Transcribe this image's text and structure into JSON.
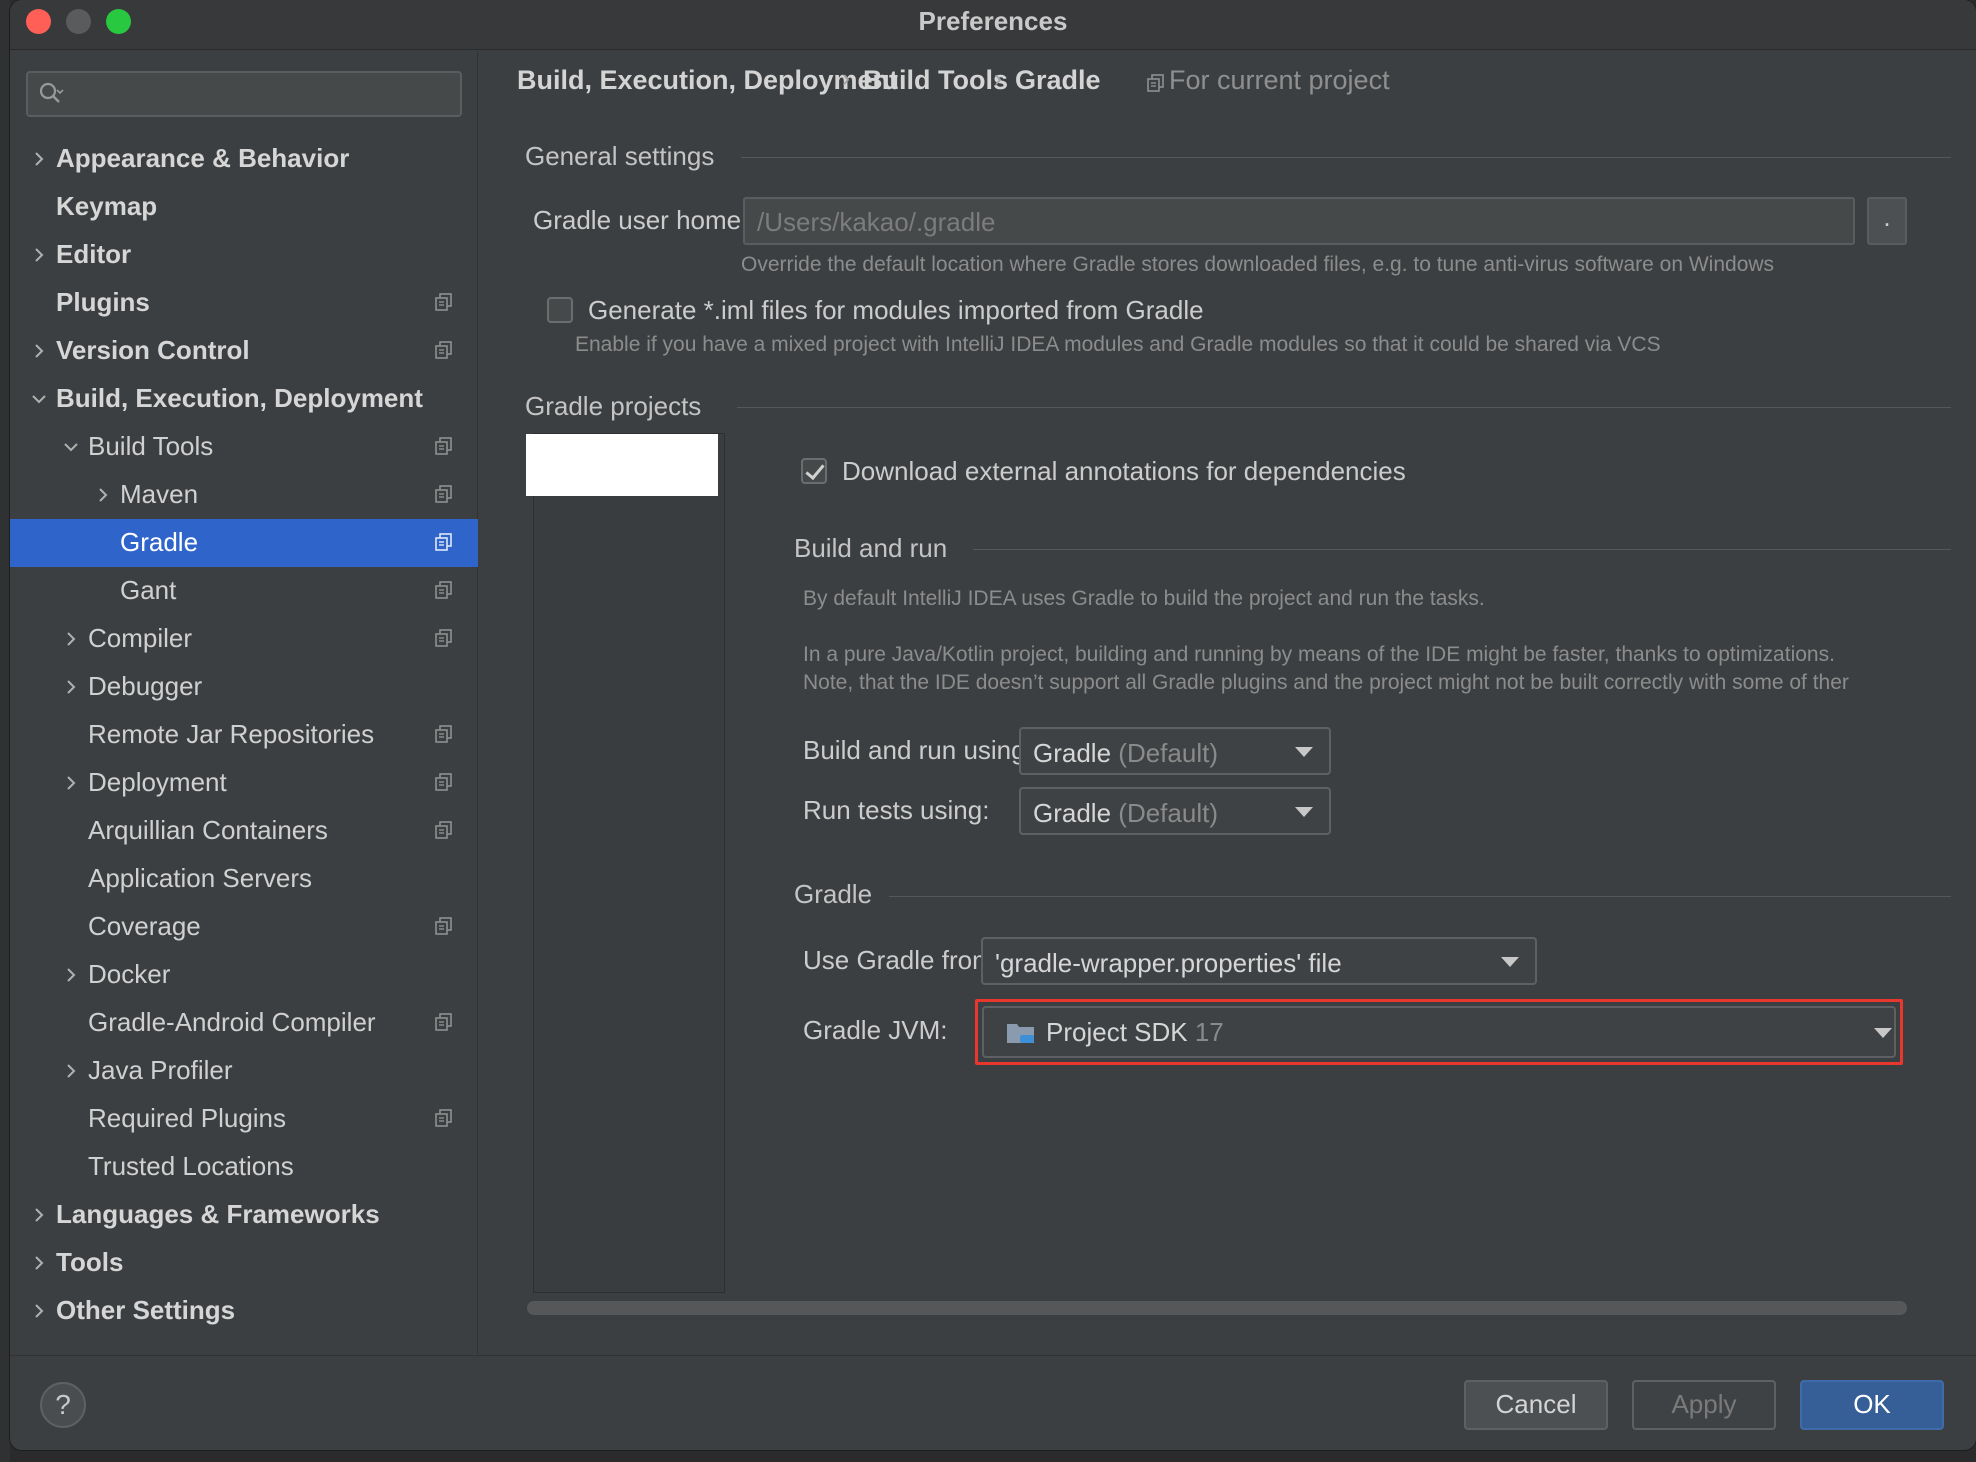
{
  "window": {
    "title": "Preferences"
  },
  "search": {
    "placeholder": ""
  },
  "sidebar": {
    "items": [
      {
        "label": "Appearance & Behavior",
        "expandable": true,
        "expanded": false,
        "bold": true
      },
      {
        "label": "Keymap",
        "expandable": false,
        "bold": true
      },
      {
        "label": "Editor",
        "expandable": true,
        "expanded": false,
        "bold": true
      },
      {
        "label": "Plugins",
        "expandable": false,
        "bold": true,
        "project_icon": true
      },
      {
        "label": "Version Control",
        "expandable": true,
        "expanded": false,
        "bold": true,
        "project_icon": true
      },
      {
        "label": "Build, Execution, Deployment",
        "expandable": true,
        "expanded": true,
        "bold": true
      },
      {
        "label": "Build Tools",
        "expandable": true,
        "expanded": true,
        "project_icon": true
      },
      {
        "label": "Maven",
        "expandable": true,
        "expanded": false,
        "project_icon": true
      },
      {
        "label": "Gradle",
        "selected": true,
        "project_icon": true
      },
      {
        "label": "Gant",
        "project_icon": true
      },
      {
        "label": "Compiler",
        "expandable": true,
        "expanded": false,
        "project_icon": true
      },
      {
        "label": "Debugger",
        "expandable": true,
        "expanded": false
      },
      {
        "label": "Remote Jar Repositories",
        "project_icon": true
      },
      {
        "label": "Deployment",
        "expandable": true,
        "expanded": false,
        "project_icon": true
      },
      {
        "label": "Arquillian Containers",
        "project_icon": true
      },
      {
        "label": "Application Servers"
      },
      {
        "label": "Coverage",
        "project_icon": true
      },
      {
        "label": "Docker",
        "expandable": true,
        "expanded": false
      },
      {
        "label": "Gradle-Android Compiler",
        "project_icon": true
      },
      {
        "label": "Java Profiler",
        "expandable": true,
        "expanded": false
      },
      {
        "label": "Required Plugins",
        "project_icon": true
      },
      {
        "label": "Trusted Locations"
      },
      {
        "label": "Languages & Frameworks",
        "expandable": true,
        "expanded": false,
        "bold": true
      },
      {
        "label": "Tools",
        "expandable": true,
        "expanded": false,
        "bold": true
      },
      {
        "label": "Other Settings",
        "expandable": true,
        "expanded": false,
        "bold": true
      }
    ]
  },
  "breadcrumb": {
    "items": [
      "Build, Execution, Deployment",
      "Build Tools",
      "Gradle"
    ],
    "separator": "›",
    "scope": "For current project"
  },
  "general": {
    "title": "General settings",
    "user_home_label": "Gradle user home:",
    "user_home_placeholder": "/Users/kakao/.gradle",
    "browse_label": ".",
    "user_home_hint": "Override the default location where Gradle stores downloaded files, e.g. to tune anti-virus software on Windows",
    "iml_label": "Generate *.iml files for modules imported from Gradle",
    "iml_checked": false,
    "iml_hint": "Enable if you have a mixed project with IntelliJ IDEA modules and Gradle modules so that it could be shared via VCS"
  },
  "projects": {
    "title": "Gradle projects",
    "download_annotations_label": "Download external annotations for dependencies",
    "download_annotations_checked": true
  },
  "build_run": {
    "title": "Build and run",
    "desc1": "By default IntelliJ IDEA uses Gradle to build the project and run the tasks.",
    "desc2": "In a pure Java/Kotlin project, building and running by means of the IDE might be faster, thanks to optimizations.",
    "desc3": "Note, that the IDE doesn’t support all Gradle plugins and the project might not be built correctly with some of ther",
    "build_using_label": "Build and run using:",
    "build_using_value": "Gradle",
    "build_using_suffix": "(Default)",
    "tests_using_label": "Run tests using:",
    "tests_using_value": "Gradle",
    "tests_using_suffix": "(Default)"
  },
  "gradle": {
    "title": "Gradle",
    "use_from_label": "Use Gradle from:",
    "use_from_value": "'gradle-wrapper.properties' file",
    "jvm_label": "Gradle JVM:",
    "jvm_value": "Project SDK",
    "jvm_version": "17"
  },
  "footer": {
    "help_label": "?",
    "cancel_label": "Cancel",
    "apply_label": "Apply",
    "ok_label": "OK"
  },
  "colors": {
    "selection": "#2f65ca",
    "highlight": "#e8382e",
    "primary_button": "#365f98"
  }
}
